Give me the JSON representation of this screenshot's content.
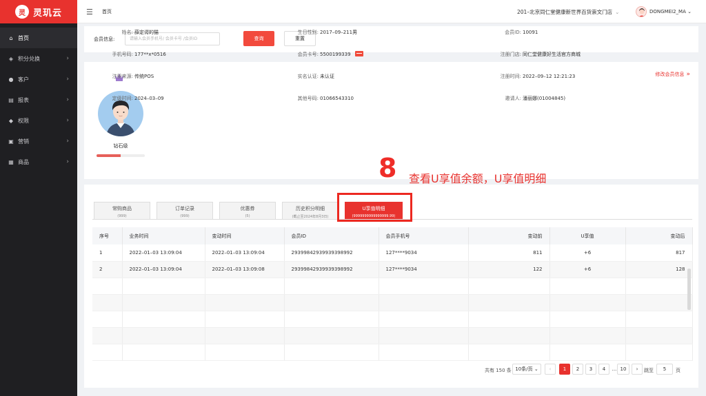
{
  "app": {
    "logo_mark": "灵",
    "name": "灵玑云"
  },
  "sidebar": {
    "items": [
      {
        "label": "首页",
        "icon": "home-icon",
        "glyph": "⌂",
        "active": true
      },
      {
        "label": "积分兑换",
        "icon": "diamond-icon",
        "glyph": "◈"
      },
      {
        "label": "客户",
        "icon": "user-icon",
        "glyph": "●"
      },
      {
        "label": "报表",
        "icon": "report-icon",
        "glyph": "▤"
      },
      {
        "label": "权限",
        "icon": "shield-icon",
        "glyph": "◆"
      },
      {
        "label": "营销",
        "icon": "marketing-icon",
        "glyph": "▣"
      },
      {
        "label": "商品",
        "icon": "goods-icon",
        "glyph": "▦"
      }
    ]
  },
  "header": {
    "breadcrumb": "首页",
    "store": "201–北京同仁堂健康新世界百货崇文门店",
    "user": "DONGMEI2_MA"
  },
  "search": {
    "label": "会员信息:",
    "placeholder": "请输入会员手机号/ 会员卡号 /会员ID",
    "query_label": "查询",
    "reset_label": "重置"
  },
  "member": {
    "level": "钻石级",
    "level_progress": 0.5,
    "edit_label": "修改会员信息",
    "edit_glyph": "»",
    "fields": {
      "name": {
        "label": "姓名:",
        "value": "薛定谔的猫"
      },
      "phone": {
        "label": "手机号码:",
        "value": "177**x*0516"
      },
      "source": {
        "label": "注册来源:",
        "value": "传统POS"
      },
      "fixed_time": {
        "label": "定级时间:",
        "value": "2024–03–09"
      },
      "birthday": {
        "label": "生日性别:",
        "value": "2017–09–211男"
      },
      "card_no": {
        "label": "会员卡号:",
        "value": "5500199339"
      },
      "realname": {
        "label": "实名认证:",
        "value": "未认证"
      },
      "other_phone": {
        "label": "其他号码:",
        "value": "01066543310"
      },
      "member_id": {
        "label": "会员ID:",
        "value": "10091"
      },
      "reg_store": {
        "label": "注册门店:",
        "value": "同仁堂健康好生活官方商城"
      },
      "reg_time": {
        "label": "注册时间:",
        "value": "2022–09–12 12:21:23"
      },
      "inviter": {
        "label": "邀请人:",
        "value": "潘丽娜(01004845)"
      }
    }
  },
  "annotation": {
    "number": "8",
    "text": "查看U享值余额，U享值明细"
  },
  "tabs": [
    {
      "label": "常购商品",
      "sub": "(999)"
    },
    {
      "label": "订单记录",
      "sub": "(999)"
    },
    {
      "label": "优惠券",
      "sub": "(5)"
    },
    {
      "label": "历史积分明细",
      "sub": "(截止至2024年8月3日)"
    },
    {
      "label": "U享值明细",
      "sub": "(9999999999999999.99)",
      "active": true
    }
  ],
  "table": {
    "headers": [
      "序号",
      "业务时间",
      "变动时间",
      "会员ID",
      "会员手机号",
      "变动前",
      "U享值",
      "变动后"
    ],
    "rows": [
      [
        "1",
        "2022–01–03 13:09:04",
        "2022–01–03 13:09:04",
        "29399842939939398992",
        "127****9034",
        "811",
        "+6",
        "817"
      ],
      [
        "2",
        "2022–01–03 13:09:04",
        "2022–01–03 13:09:08",
        "29399842939939398992",
        "127****9034",
        "122",
        "+6",
        "128"
      ],
      [
        "",
        "",
        "",
        "",
        "",
        "",
        "",
        ""
      ],
      [
        "",
        "",
        "",
        "",
        "",
        "",
        "",
        ""
      ],
      [
        "",
        "",
        "",
        "",
        "",
        "",
        "",
        ""
      ],
      [
        "",
        "",
        "",
        "",
        "",
        "",
        "",
        ""
      ],
      [
        "",
        "",
        "",
        "",
        "",
        "",
        "",
        ""
      ],
      [
        "",
        "",
        "",
        "",
        "",
        "",
        "",
        ""
      ]
    ]
  },
  "pagination": {
    "total": "共有 150 条",
    "page_size": "10条/页",
    "pages": [
      "1",
      "2",
      "3",
      "4",
      "...",
      "10"
    ],
    "prev": "‹",
    "next": "›",
    "jump_label": "跳至",
    "jump_value": "5",
    "page_unit": "页"
  }
}
